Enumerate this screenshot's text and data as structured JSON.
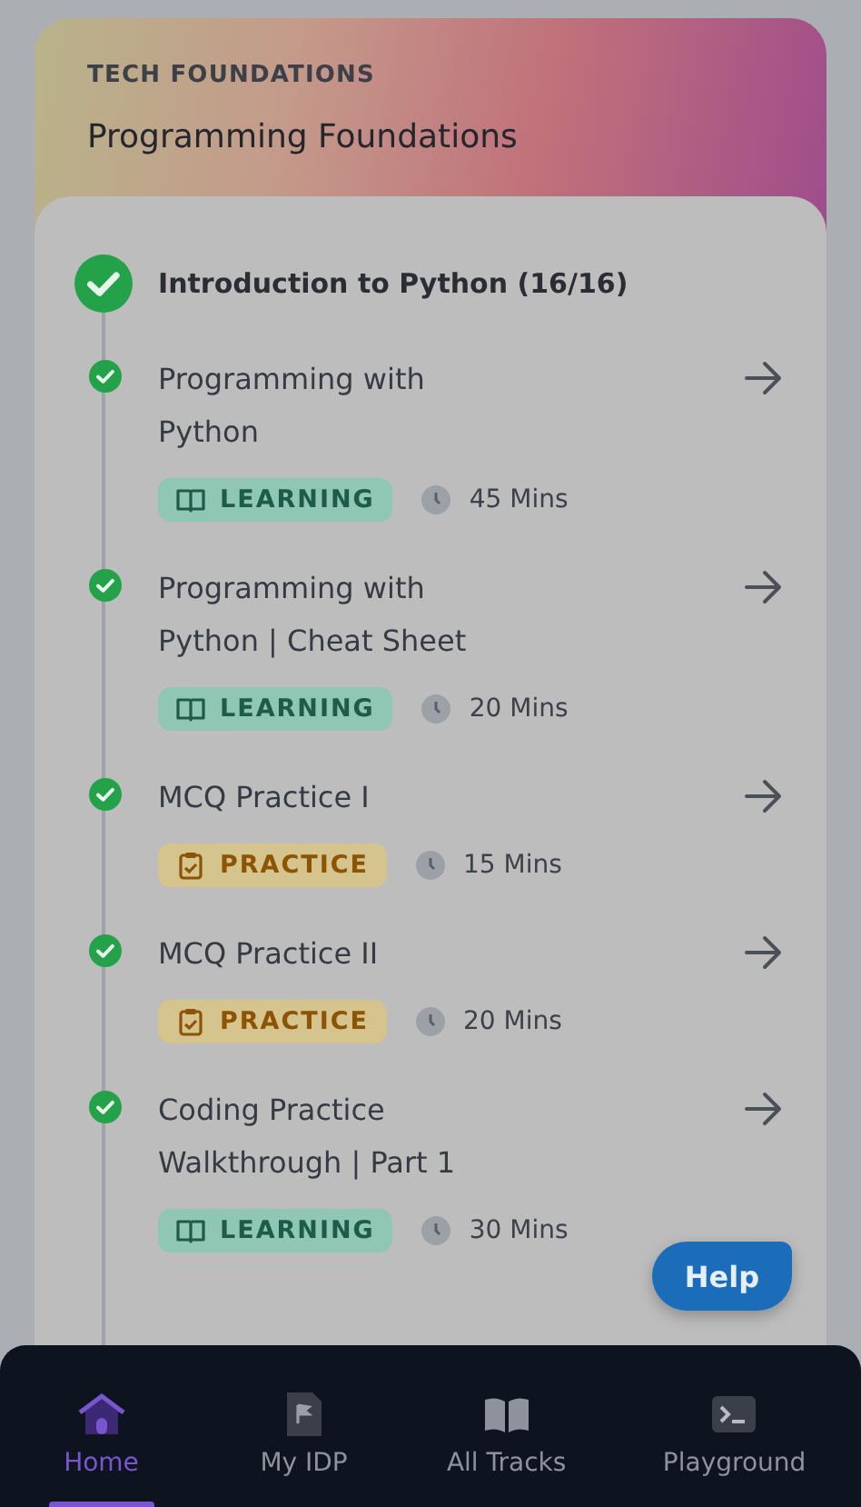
{
  "header": {
    "eyebrow": "TECH FOUNDATIONS",
    "title": "Programming Foundations"
  },
  "section": {
    "title": "Introduction to Python (16/16)",
    "completed": true
  },
  "items": [
    {
      "title": "Programming with Python",
      "kind": "learning",
      "badge": "LEARNING",
      "duration": "45 Mins",
      "completed": true
    },
    {
      "title": "Programming with Python | Cheat Sheet",
      "kind": "learning",
      "badge": "LEARNING",
      "duration": "20 Mins",
      "completed": true
    },
    {
      "title": "MCQ Practice I",
      "kind": "practice",
      "badge": "PRACTICE",
      "duration": "15 Mins",
      "completed": true
    },
    {
      "title": "MCQ Practice II",
      "kind": "practice",
      "badge": "PRACTICE",
      "duration": "20 Mins",
      "completed": true
    },
    {
      "title": "Coding Practice Walkthrough | Part 1",
      "kind": "learning",
      "badge": "LEARNING",
      "duration": "30 Mins",
      "completed": true
    }
  ],
  "help_button": "Help",
  "nav": [
    {
      "label": "Home",
      "kind": "home",
      "selected": true
    },
    {
      "label": "My IDP",
      "kind": "flag",
      "selected": false
    },
    {
      "label": "All Tracks",
      "kind": "book",
      "selected": false
    },
    {
      "label": "Playground",
      "kind": "terminal",
      "selected": false
    }
  ]
}
